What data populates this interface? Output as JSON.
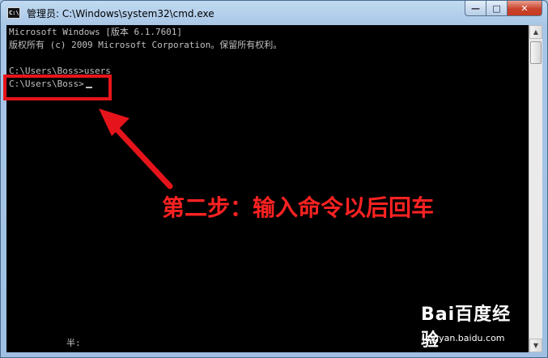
{
  "window": {
    "title": "管理员: C:\\Windows\\system32\\cmd.exe",
    "icon": "cmd-app-icon",
    "buttons": {
      "minimize": "—",
      "maximize": "□",
      "close": "✕"
    }
  },
  "console": {
    "lines": [
      "Microsoft Windows [版本 6.1.7601]",
      "版权所有 (c) 2009 Microsoft Corporation。保留所有权利。",
      "",
      "C:\\Users\\Boss>users",
      "C:\\Users\\Boss>"
    ],
    "ime_indicator": "半:"
  },
  "annotation": {
    "text": "第二步：输入命令以后回车",
    "color": "#ff2222"
  },
  "watermark": {
    "logo": "Bai百度经验",
    "subtitle": "jingyan.baidu.com"
  },
  "colors": {
    "console_bg": "#000000",
    "console_text": "#c0c0c0",
    "highlight": "#e5141b"
  }
}
